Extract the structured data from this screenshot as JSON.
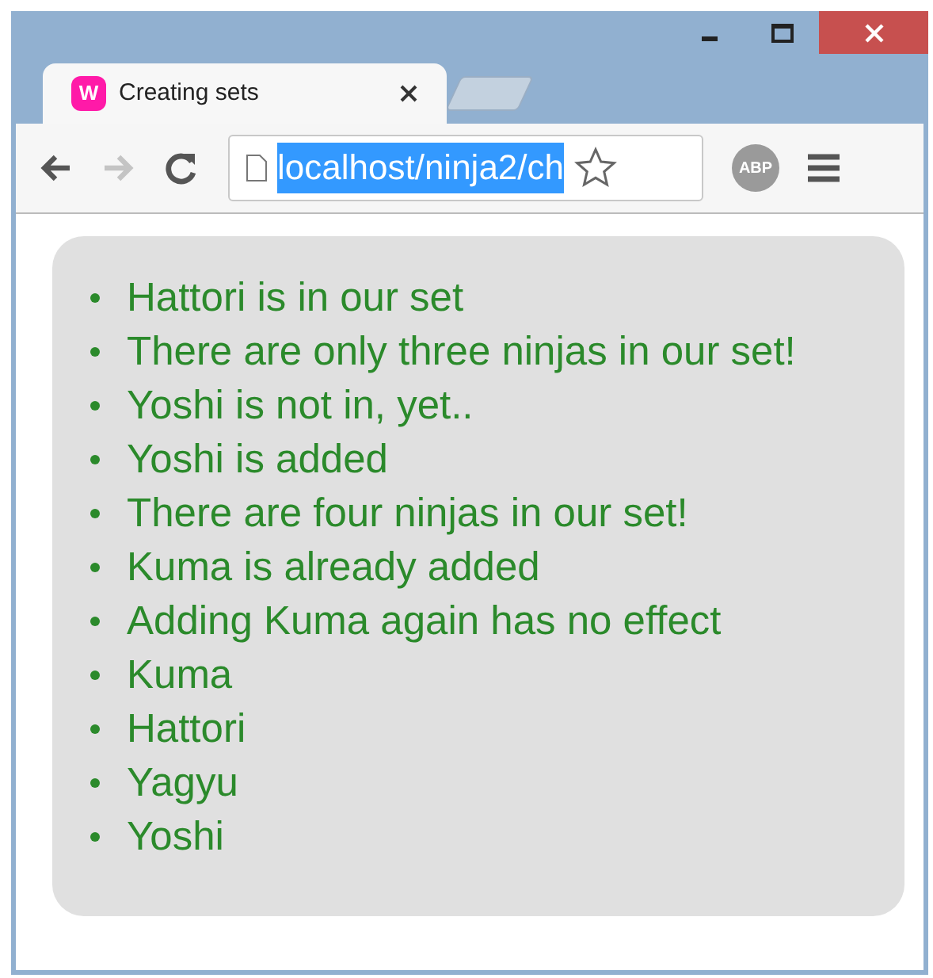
{
  "window": {
    "controls": [
      {
        "kind": "minimize"
      },
      {
        "kind": "maximize"
      },
      {
        "kind": "close"
      }
    ]
  },
  "tabs": [
    {
      "kind": "page",
      "favicon_letter": "W",
      "title": "Creating sets",
      "selected": true
    },
    {
      "kind": "new",
      "selected": false
    }
  ],
  "toolbar": {
    "url": "localhost/ninja2/ch",
    "url_selected": true,
    "forward_disabled": true,
    "extension_label": "ABP"
  },
  "list": [
    "Hattori is in our set",
    "There are only three ninjas in our set!",
    "Yoshi is not in, yet..",
    "Yoshi is added",
    "There are four ninjas in our set!",
    "Kuma is already added",
    "Adding Kuma again has no effect",
    "Kuma",
    "Hattori",
    "Yagyu",
    "Yoshi"
  ]
}
